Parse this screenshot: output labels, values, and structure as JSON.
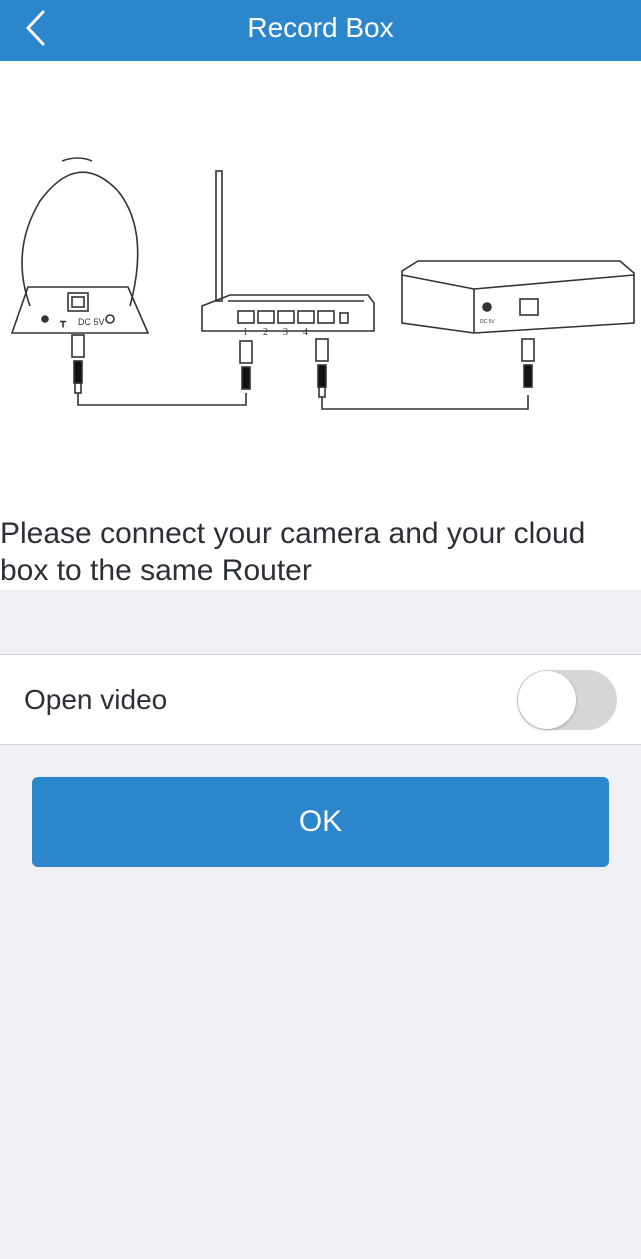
{
  "header": {
    "title": "Record Box",
    "back_icon": "chevron-left-icon"
  },
  "diagram": {
    "camera_label": "DC 5V",
    "router_port_labels": [
      "1",
      "2",
      "3",
      "4"
    ],
    "cloud_box_label": "DC 5V"
  },
  "instruction": "Please connect your camera and your cloud box to the same Router",
  "settings": {
    "open_video": {
      "label": "Open video",
      "enabled": false
    }
  },
  "actions": {
    "ok_label": "OK"
  },
  "colors": {
    "header": "#2b86cc",
    "button": "#2b86cc",
    "background": "#efeff4",
    "toggle_off": "#d6d6d6"
  }
}
